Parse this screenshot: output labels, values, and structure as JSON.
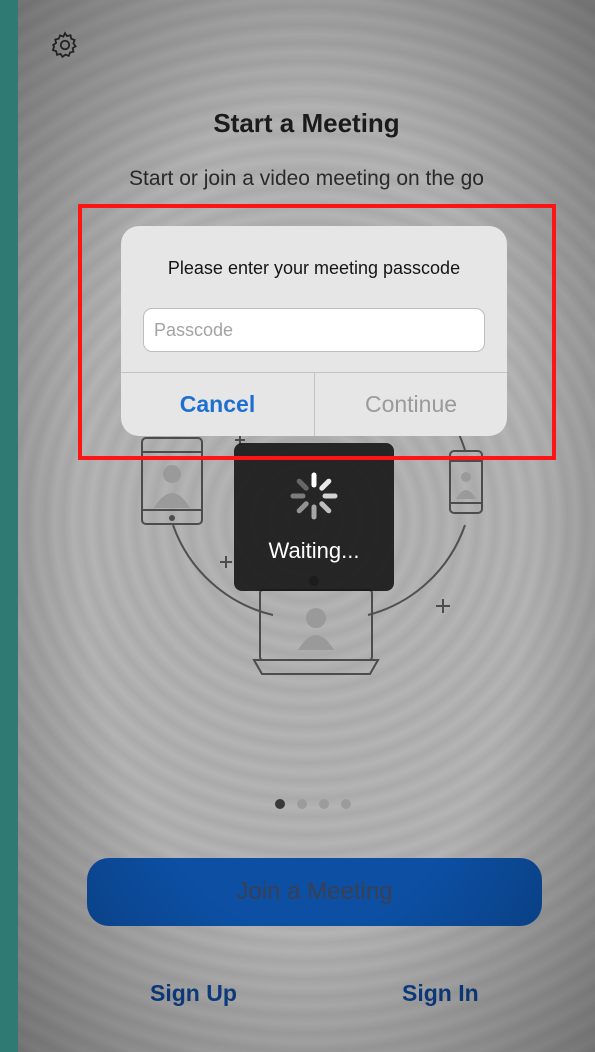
{
  "header": {
    "title": "Start a Meeting",
    "subtitle": "Start or join a video meeting on the go"
  },
  "dialog": {
    "message": "Please enter your meeting passcode",
    "input_placeholder": "Passcode",
    "input_value": "",
    "cancel_label": "Cancel",
    "continue_label": "Continue"
  },
  "hud": {
    "label": "Waiting..."
  },
  "pager": {
    "total": 4,
    "active_index": 0
  },
  "actions": {
    "join_label": "Join a Meeting",
    "signup_label": "Sign Up",
    "signin_label": "Sign In"
  },
  "icons": {
    "settings": "gear-icon",
    "loading": "spinner-icon"
  },
  "colors": {
    "accent_blue": "#1f6fd0",
    "join_button": "#0c4fa3",
    "highlight_border": "#ff1414"
  }
}
